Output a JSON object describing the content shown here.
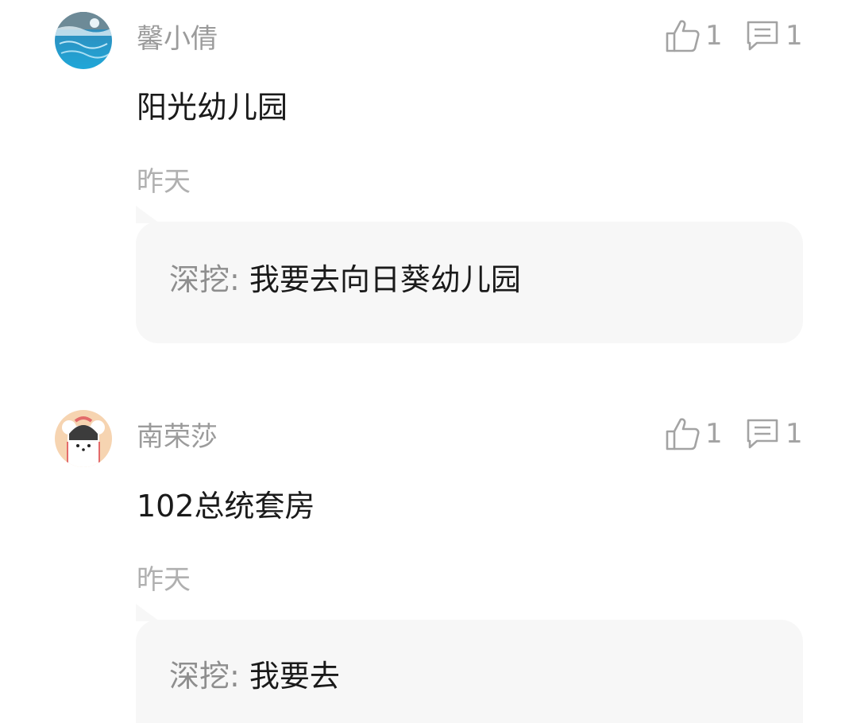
{
  "comments": [
    {
      "username": "馨小倩",
      "content": "阳光幼儿园",
      "time": "昨天",
      "likes": "1",
      "replies_count": "1",
      "reply": {
        "author": "深挖:",
        "text": "我要去向日葵幼儿园"
      },
      "avatar_icon": "swimming-pool-photo-avatar"
    },
    {
      "username": "南荣莎",
      "content": "102总统套房",
      "time": "昨天",
      "likes": "1",
      "replies_count": "1",
      "reply": {
        "author": "深挖:",
        "text": "我要去"
      },
      "avatar_icon": "cartoon-bear-avatar"
    }
  ],
  "icons": {
    "like": "thumbs-up-icon",
    "reply": "comment-icon"
  },
  "colors": {
    "username": "#9b9b9b",
    "content": "#1a1a1a",
    "muted": "#b0b0b0",
    "reply_bg": "#f7f7f7"
  }
}
